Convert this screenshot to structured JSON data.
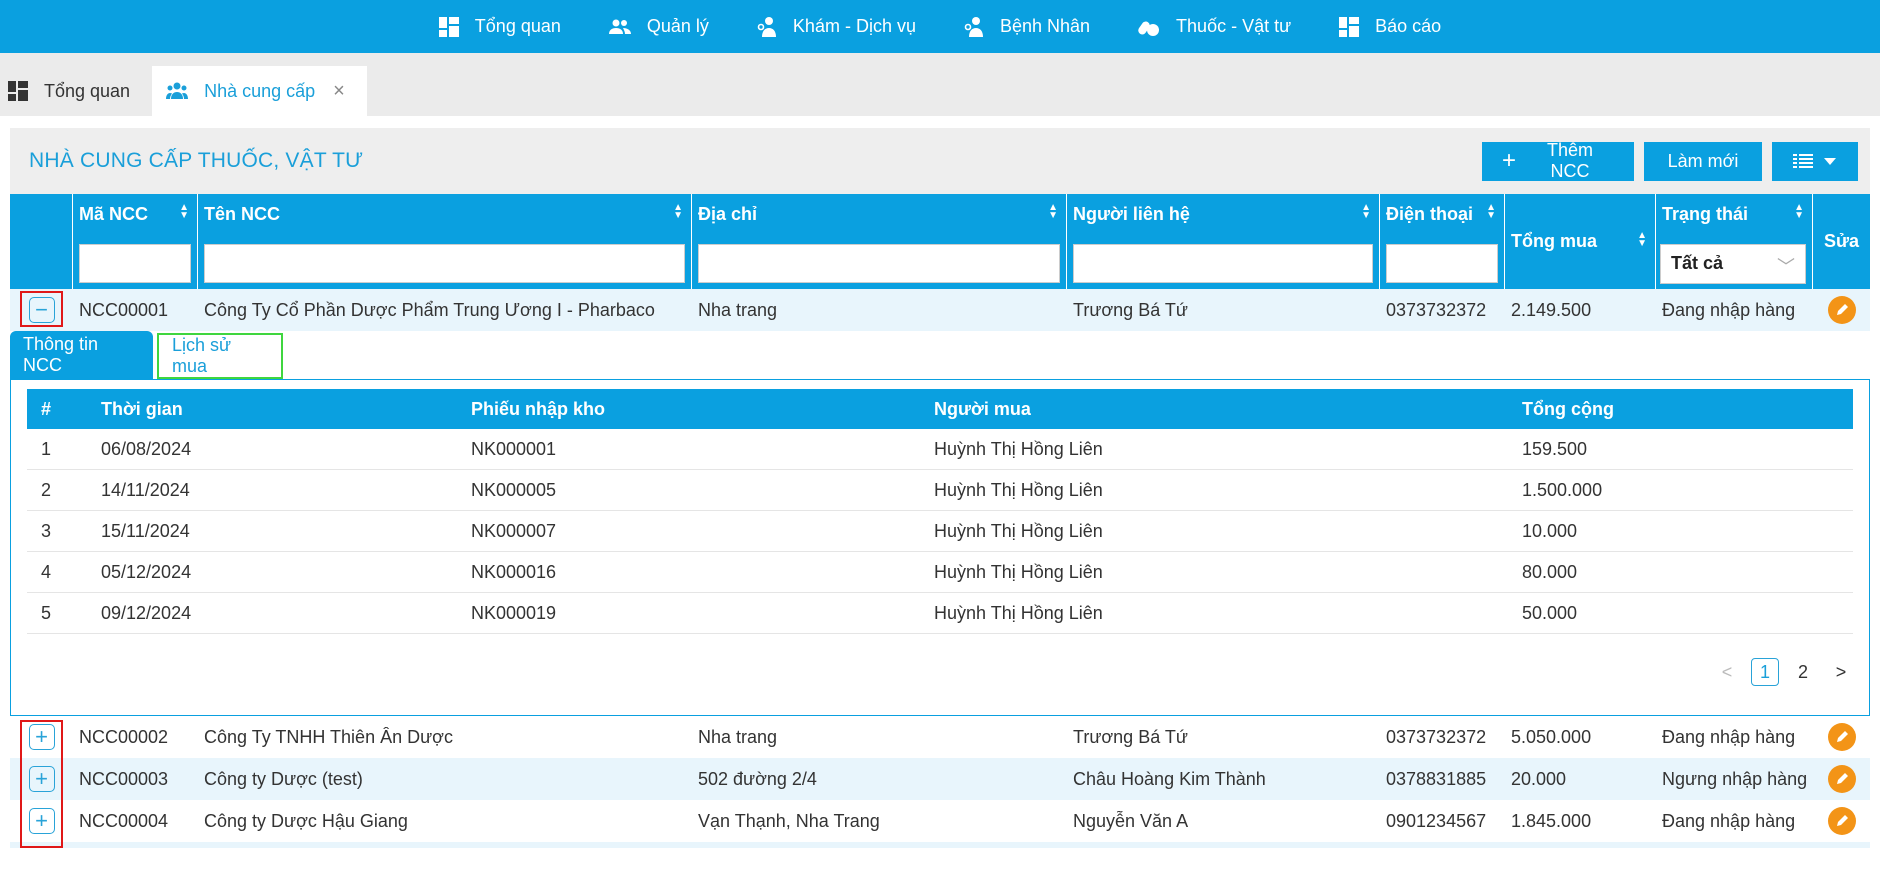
{
  "nav": {
    "items": [
      {
        "label": "Tổng quan",
        "icon": "dashboard-icon"
      },
      {
        "label": "Quản lý",
        "icon": "users-icon"
      },
      {
        "label": "Khám - Dịch vụ",
        "icon": "doctor-icon"
      },
      {
        "label": "Bệnh Nhân",
        "icon": "patient-icon"
      },
      {
        "label": "Thuốc - Vật tư",
        "icon": "pills-icon"
      },
      {
        "label": "Báo cáo",
        "icon": "report-icon"
      }
    ]
  },
  "tabs": {
    "overview": "Tổng quan",
    "supplier": "Nhà cung cấp",
    "close": "×"
  },
  "panel": {
    "title": "NHÀ CUNG CẤP THUỐC, VẬT TƯ",
    "add_label": "Thêm NCC",
    "refresh_label": "Làm mới"
  },
  "columns": {
    "code": "Mã NCC",
    "name": "Tên NCC",
    "address": "Địa chỉ",
    "contact": "Người liên hệ",
    "phone": "Điện thoại",
    "total": "Tổng mua",
    "status": "Trạng thái",
    "status_filter": "Tất cả",
    "edit": "Sửa"
  },
  "suppliers": [
    {
      "code": "NCC00001",
      "name": "Công Ty Cổ Phần Dược Phẩm Trung Ương I - Pharbaco",
      "address": "Nha trang",
      "contact": "Trương Bá Tứ",
      "phone": "0373732372",
      "total": "2.149.500",
      "status": "Đang nhập hàng"
    },
    {
      "code": "NCC00002",
      "name": "Công Ty TNHH Thiên Ân Dược",
      "address": "Nha trang",
      "contact": "Trương Bá Tứ",
      "phone": "0373732372",
      "total": "5.050.000",
      "status": "Đang nhập hàng"
    },
    {
      "code": "NCC00003",
      "name": "Công ty Dược (test)",
      "address": "502 đường 2/4",
      "contact": "Châu Hoàng Kim Thành",
      "phone": "0378831885",
      "total": "20.000",
      "status": "Ngưng nhập hàng"
    },
    {
      "code": "NCC00004",
      "name": "Công ty Dược Hậu Giang",
      "address": "Vạn Thạnh, Nha Trang",
      "contact": "Nguyễn Văn A",
      "phone": "0901234567",
      "total": "1.845.000",
      "status": "Đang nhập hàng"
    }
  ],
  "detail": {
    "tab_info": "Thông tin NCC",
    "tab_history": "Lịch sử mua",
    "headers": {
      "num": "#",
      "time": "Thời gian",
      "receipt": "Phiếu nhập kho",
      "buyer": "Người mua",
      "sum": "Tổng cộng"
    },
    "rows": [
      {
        "num": "1",
        "time": "06/08/2024",
        "receipt": "NK000001",
        "buyer": "Huỳnh Thị Hồng Liên",
        "sum": "159.500"
      },
      {
        "num": "2",
        "time": "14/11/2024",
        "receipt": "NK000005",
        "buyer": "Huỳnh Thị Hồng Liên",
        "sum": "1.500.000"
      },
      {
        "num": "3",
        "time": "15/11/2024",
        "receipt": "NK000007",
        "buyer": "Huỳnh Thị Hồng Liên",
        "sum": "10.000"
      },
      {
        "num": "4",
        "time": "05/12/2024",
        "receipt": "NK000016",
        "buyer": "Huỳnh Thị Hồng Liên",
        "sum": "80.000"
      },
      {
        "num": "5",
        "time": "09/12/2024",
        "receipt": "NK000019",
        "buyer": "Huỳnh Thị Hồng Liên",
        "sum": "50.000"
      }
    ],
    "pager": {
      "prev": "<",
      "page1": "1",
      "page2": "2",
      "next": ">"
    }
  },
  "expander": {
    "minus": "−",
    "plus": "+"
  }
}
